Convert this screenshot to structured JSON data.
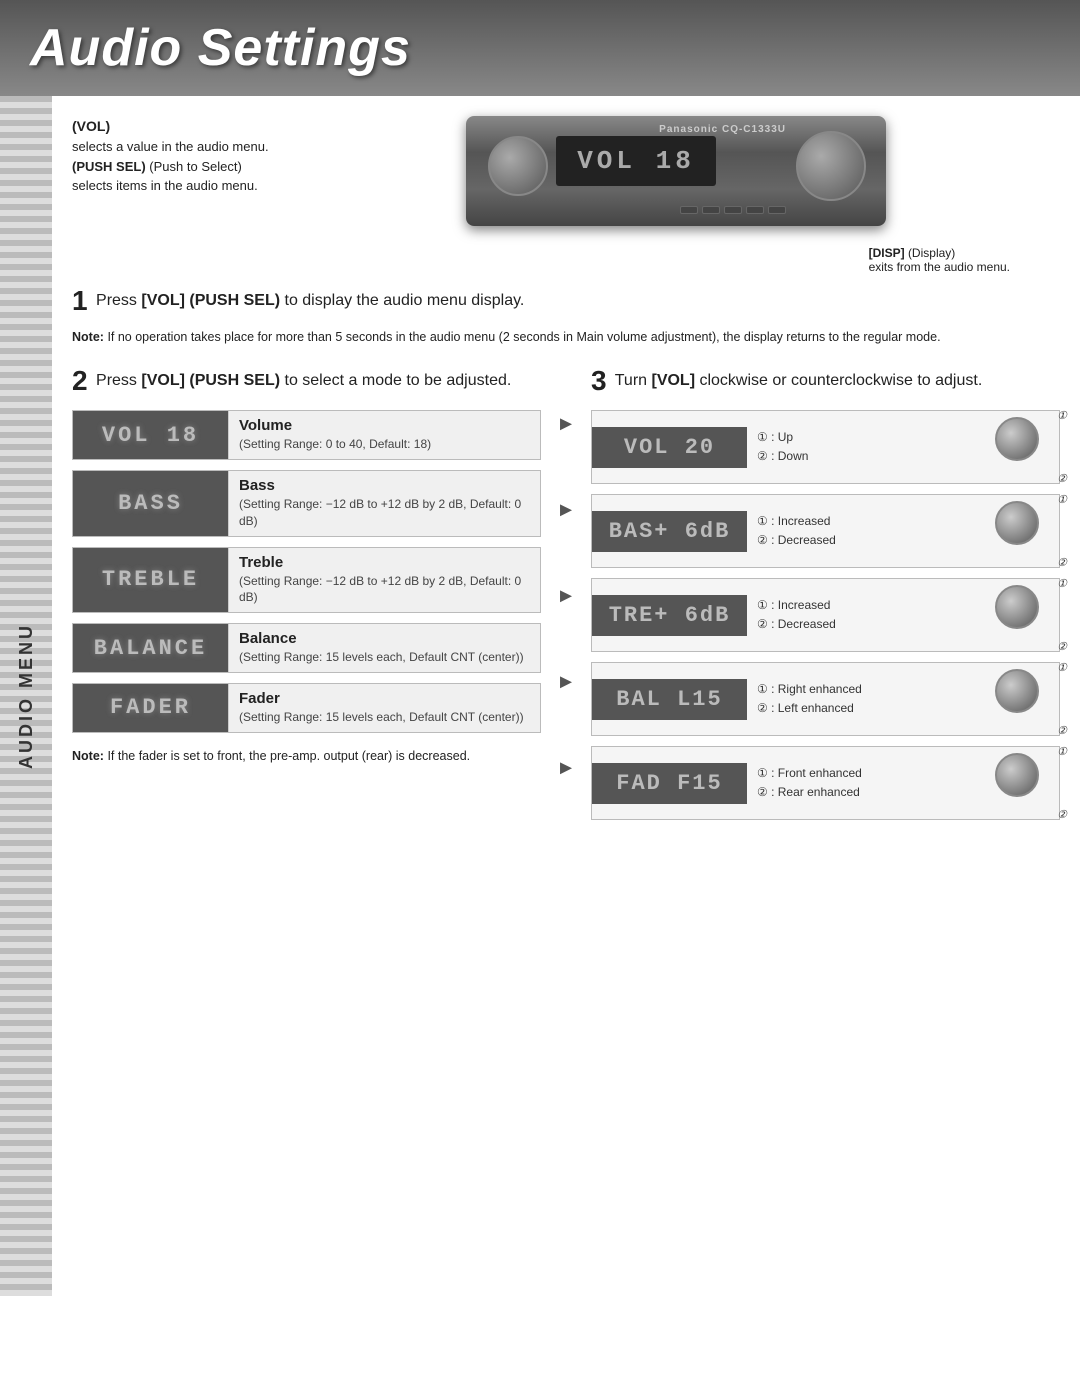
{
  "header": {
    "title": "Audio Settings"
  },
  "sidebar": {
    "label": "Audio menu"
  },
  "vol_section": {
    "label": "(VOL)",
    "desc1": "selects a value in the audio menu.",
    "push_sel": "(PUSH SEL)",
    "push_sel_suffix": " (Push to Select)",
    "desc2": "selects items in the audio menu.",
    "stereo_display": "VOL  18",
    "disp_label": "[DISP]",
    "disp_suffix": " (Display)",
    "disp_desc": "exits from the audio menu."
  },
  "step1": {
    "number": "1",
    "text_before": "Press ",
    "bold": "[VOL] (PUSH SEL)",
    "text_after": " to display the audio menu display.",
    "note_label": "Note:",
    "note_text": " If no operation takes place for more than 5 seconds in the audio menu (2 seconds in Main volume adjustment), the display returns to the regular mode."
  },
  "step2": {
    "number": "2",
    "text_before": "Press ",
    "bold": "[VOL] (PUSH SEL)",
    "text_after": " to select a mode to be adjusted."
  },
  "step3": {
    "number": "3",
    "text_before": "Turn ",
    "bold": "[VOL]",
    "text_after": " clockwise or counterclockwise to adjust."
  },
  "menu_items": [
    {
      "display": "VOL  18",
      "label": "Volume",
      "desc": "(Setting Range: 0 to 40, Default: 18)"
    },
    {
      "display": "BASS",
      "label": "Bass",
      "desc": "(Setting Range: −12 dB to +12 dB by 2 dB, Default: 0 dB)"
    },
    {
      "display": "TREBLE",
      "label": "Treble",
      "desc": "(Setting Range: −12 dB to +12 dB by 2 dB, Default: 0 dB)"
    },
    {
      "display": "BALANCE",
      "label": "Balance",
      "desc": "(Setting Range: 15 levels each, Default CNT (center))"
    },
    {
      "display": "FADER",
      "label": "Fader",
      "desc": "(Setting Range: 15 levels each, Default CNT (center))"
    }
  ],
  "right_items": [
    {
      "display": "VOL  20",
      "info_1": "① : Up",
      "info_2": "② : Down"
    },
    {
      "display": "BAS+ 6dB",
      "info_1": "① : Increased",
      "info_2": "② : Decreased"
    },
    {
      "display": "TRE+ 6dB",
      "info_1": "① : Increased",
      "info_2": "② : Decreased"
    },
    {
      "display": "BAL L15",
      "info_1": "① : Right enhanced",
      "info_2": "② : Left enhanced"
    },
    {
      "display": "FAD F15",
      "info_1": "① : Front enhanced",
      "info_2": "② : Rear enhanced"
    }
  ],
  "bottom_note": {
    "label": "Note:",
    "text": " If the fader is set to front, the pre-amp. output (rear) is decreased."
  }
}
